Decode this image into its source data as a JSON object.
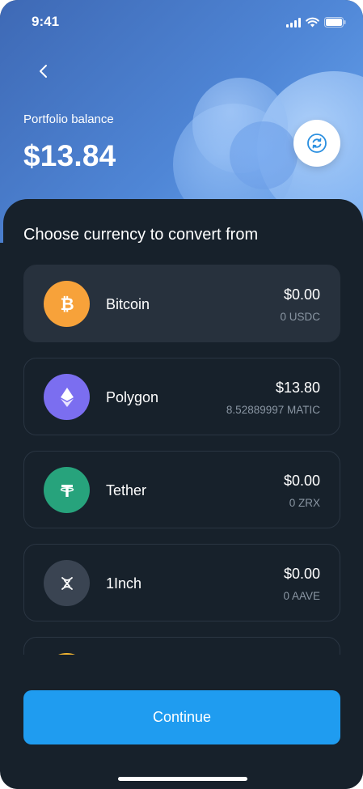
{
  "status_bar": {
    "time": "9:41"
  },
  "header": {
    "balance_label": "Portfolio balance",
    "balance_value": "$13.84"
  },
  "sheet": {
    "title": "Choose currency to convert from",
    "currencies": [
      {
        "name": "Bitcoin",
        "fiat": "$0.00",
        "amount": "0 USDC",
        "icon": "bitcoin-icon",
        "color": "#f7a23a",
        "selected": true
      },
      {
        "name": "Polygon",
        "fiat": "$13.80",
        "amount": "8.52889997 MATIC",
        "icon": "ethereum-icon",
        "color": "#7b6ef0",
        "selected": false
      },
      {
        "name": "Tether",
        "fiat": "$0.00",
        "amount": "0 ZRX",
        "icon": "tether-icon",
        "color": "#27a37c",
        "selected": false
      },
      {
        "name": "1Inch",
        "fiat": "$0.00",
        "amount": "0 AAVE",
        "icon": "1inch-icon",
        "color": "#3a4452",
        "selected": false
      },
      {
        "name": "",
        "fiat": "",
        "amount": "",
        "icon": "coin-icon",
        "color": "#f2b531",
        "selected": false
      }
    ]
  },
  "actions": {
    "continue_label": "Continue"
  },
  "colors": {
    "accent": "#1f9cf0",
    "sheet_bg": "#17212b",
    "card_selected": "#27313d"
  }
}
